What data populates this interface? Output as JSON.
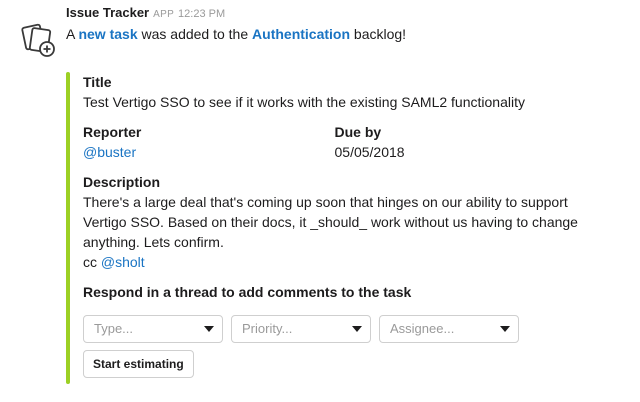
{
  "message": {
    "sender": "Issue Tracker",
    "badge": "APP",
    "time": "12:23 PM",
    "text_a": "A",
    "new_task_link": "new task",
    "text_b": "was added to the",
    "project_link": "Authentication",
    "text_c": "backlog!"
  },
  "attachment": {
    "accent_color": "#9cd024",
    "title_label": "Title",
    "title_value": "Test Vertigo SSO to see if it works with the existing SAML2 functionality",
    "reporter_label": "Reporter",
    "reporter_value": "@buster",
    "due_label": "Due by",
    "due_value": "05/05/2018",
    "description_label": "Description",
    "description_text": "There's a large deal that's coming up soon that hinges on our ability to support Vertigo SSO. Based on their docs, it _should_ work without us having to change anything. Lets confirm.",
    "cc_prefix": "cc",
    "cc_user": "@sholt",
    "respond_hint": "Respond in a thread to add comments to the task",
    "selects": [
      {
        "placeholder": "Type..."
      },
      {
        "placeholder": "Priority..."
      },
      {
        "placeholder": "Assignee..."
      }
    ],
    "button_label": "Start estimating"
  },
  "icons": {
    "avatar": "cards-add-icon",
    "caret": "caret-down-icon"
  }
}
